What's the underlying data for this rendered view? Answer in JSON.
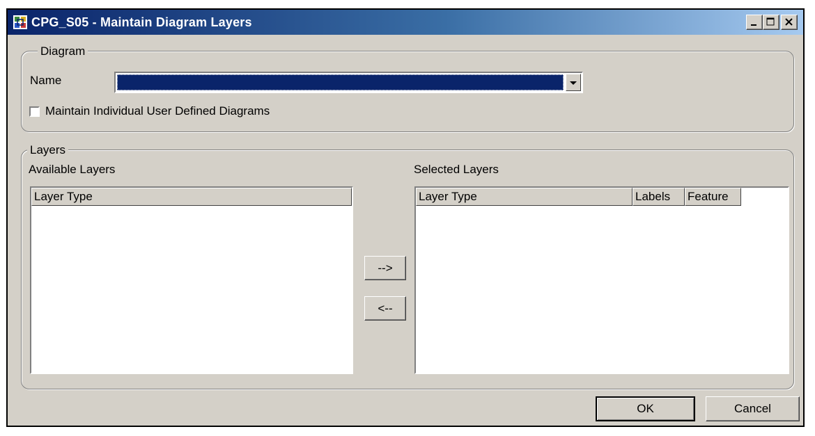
{
  "window": {
    "title": "CPG_S05 - Maintain Diagram Layers",
    "icon": "diagram-layers-app-icon",
    "controls": [
      "minimize-icon",
      "maximize-icon",
      "close-icon"
    ]
  },
  "diagram_group": {
    "legend": "Diagram",
    "name_label": "Name",
    "name_value": "",
    "checkbox_label": "Maintain Individual User Defined Diagrams",
    "checkbox_checked": false
  },
  "layers_group": {
    "legend": "Layers",
    "available": {
      "label": "Available Layers",
      "columns": [
        "Layer Type"
      ],
      "rows": []
    },
    "selected": {
      "label": "Selected Layers",
      "columns": [
        "Layer Type",
        "Labels",
        "Feature"
      ],
      "rows": []
    },
    "add_button": "-->",
    "remove_button": "<--"
  },
  "footer": {
    "ok": "OK",
    "cancel": "Cancel"
  },
  "colors": {
    "titlebar_start": "#0a246a",
    "titlebar_end": "#a6caf0",
    "face": "#d4d0c8",
    "selection": "#0a246a"
  }
}
